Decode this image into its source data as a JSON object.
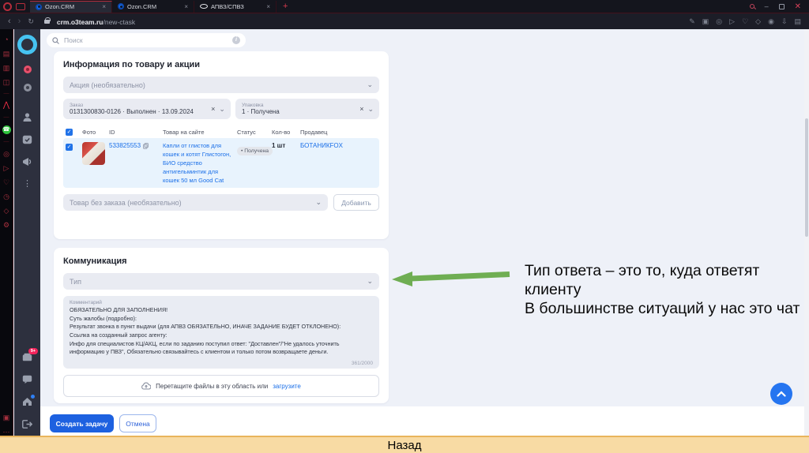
{
  "browser": {
    "tabs": [
      {
        "label": "Ozon.CRM",
        "favicon": "ozon-blue-circle"
      },
      {
        "label": "Ozon.CRM",
        "favicon": "ozon-blue-circle"
      },
      {
        "label": "АПВЗ/СПВЗ",
        "favicon": "white-ellipse"
      }
    ],
    "new_tab_label": "+",
    "url_domain": "crm.o3team.ru",
    "url_path": "/new-ctask",
    "toolbar_icons": [
      "back-icon",
      "forward-icon",
      "reload-icon",
      "lock-icon",
      "share-icon",
      "screenshot-icon",
      "target-icon",
      "send-icon",
      "heart-icon",
      "cube-icon",
      "profile-icon",
      "download-icon",
      "panels-icon"
    ],
    "gx_sidebar_icons": [
      "speed-dial-icon",
      "box-icon",
      "monitor-icon",
      "grid-icon",
      "gx-logo-icon",
      "whatsapp-icon",
      "target-icon",
      "play-icon",
      "heart-icon",
      "history-icon",
      "cube-icon",
      "settings-gear-icon",
      "snapshot-icon",
      "more-icon"
    ]
  },
  "app": {
    "sidebar_icons": [
      "ozon-logo",
      "red-status-dot",
      "gray-status-dot",
      "profile-icon",
      "tasks-icon",
      "announce-icon",
      "more-dots-icon",
      "orders-badge-icon",
      "feedback-icon",
      "home-icon",
      "logout-icon"
    ],
    "orders_badge": "9+",
    "search_placeholder": "Поиск",
    "product_card": {
      "title": "Информация по товару и акции",
      "action_select_placeholder": "Акция (необязательно)",
      "order_select": {
        "label": "Заказ",
        "value": "0131300830-0126 · Выполнен · 13.09.2024"
      },
      "package_select": {
        "label": "Упаковка",
        "value": "1 · Получена"
      },
      "table": {
        "headers": [
          "Фото",
          "ID",
          "Товар на сайте",
          "Статус",
          "Кол-во",
          "Продавец"
        ],
        "row": {
          "id": "533825553",
          "product": "Капли от глистов для кошек и котят Глистогон, БИО средство антигельминтик для кошек 50 мл Good Cat",
          "status": "Получена",
          "qty": "1 шт",
          "seller": "БОТАНИКFOX"
        }
      },
      "no_order_select_placeholder": "Товар без заказа (необязательно)",
      "add_button_label": "Добавить"
    },
    "communication_card": {
      "title": "Коммуникация",
      "type_select_placeholder": "Тип",
      "comment": {
        "label": "Комментарий",
        "lines": [
          "ОБЯЗАТЕЛЬНО ДЛЯ ЗАПОЛНЕНИЯ!",
          "Суть жалобы (подробно):",
          "Результат звонка в пункт выдачи (для АПВЗ ОБЯЗАТЕЛЬНО, ИНАЧЕ ЗАДАНИЕ БУДЕТ ОТКЛОНЕНО):",
          "Ссылка на созданный запрос агенту:",
          "Инфо для специалистов КЦ/АКЦ, если по заданию поступил ответ: \"Доставлен\"/\"Не удалось уточнить информацию у ПВЗ\", Обязательно связывайтесь с клиентом и только потом возвращаете деньги."
        ],
        "counter": "361/2000"
      },
      "upload_text": "Перетащите файлы в эту область или",
      "upload_link": "загрузите"
    },
    "footer": {
      "submit_label": "Создать задачу",
      "cancel_label": "Отмена"
    }
  },
  "annotation": {
    "line1": "Тип ответа – это то, куда ответят клиенту",
    "line2": "В большинстве ситуаций у нас это чат",
    "arrow_color": "#6fae53"
  },
  "bottom_bar": {
    "label": "Назад"
  },
  "colors": {
    "accent_blue": "#1a6fe8",
    "primary_button": "#1d61e0",
    "selected_row": "#e8f3fd",
    "content_bg": "#eef1f8",
    "chrome_bg": "#14151d",
    "bottom_bar_bg": "#f8dba4",
    "ozon_ring": "#46c3f1"
  }
}
